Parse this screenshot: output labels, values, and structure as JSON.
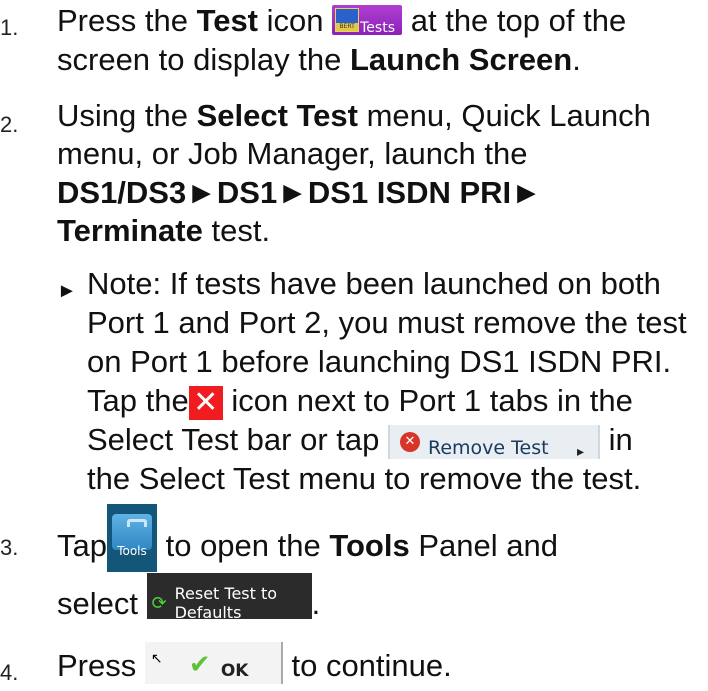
{
  "steps": [
    {
      "number": "1.",
      "text": {
        "a": "Press the ",
        "b_test": "Test",
        "c": " icon ",
        "d": " at the top of the",
        "e": "screen to display the ",
        "f_launch": "Launch Screen",
        "g": "."
      }
    },
    {
      "number": "2.",
      "text": {
        "a": "Using the ",
        "b_select": "Select Test",
        "c": " menu, Quick Launch",
        "d": "menu, or Job Manager, launch the",
        "e_path": "DS1/DS3►DS1►DS1 ISDN PRI►",
        "f_term": "Terminate",
        "g": " test."
      }
    },
    {
      "number": "3.",
      "text": {
        "a": "Tap",
        "b": " to open the ",
        "c_tools": "Tools",
        "d": " Panel and",
        "e": "select ",
        "f": "."
      }
    },
    {
      "number": "4.",
      "text": {
        "a": "Press ",
        "b": " to continue."
      }
    }
  ],
  "note": {
    "arrow": "►",
    "l1": "Note: If tests have been launched on both",
    "l2": "Port 1 and Port 2, you must remove the test",
    "l3": "on Port 1 before launching DS1 ISDN PRI.",
    "l4a": "Tap the",
    "l4b": " icon next to Port 1 tabs in the",
    "l5a": "Select Test bar or tap ",
    "l5b": " in",
    "l6": "the Select Test menu to remove the test."
  },
  "icons": {
    "tests": {
      "name": "tests-icon",
      "label": "Tests",
      "badge": "BERT"
    },
    "close": {
      "name": "close-icon",
      "glyph": "✕"
    },
    "remove_test": {
      "name": "remove-test-button",
      "label": "Remove Test",
      "arrow": "▸"
    },
    "tools": {
      "name": "tools-icon",
      "label": "Tools"
    },
    "reset": {
      "name": "reset-defaults-button",
      "line1": "Reset Test to",
      "line2": "Defaults",
      "glyph": "⟳"
    },
    "ok": {
      "name": "ok-button",
      "label": "OK",
      "check": "✔",
      "cursor": "↖"
    }
  },
  "colors": {
    "close_bg": "#f11c20",
    "tests_bg": "#9a2fc4",
    "tools_bg": "#14557a",
    "reset_bg": "#2b2b2b",
    "check": "#5fc23a"
  }
}
